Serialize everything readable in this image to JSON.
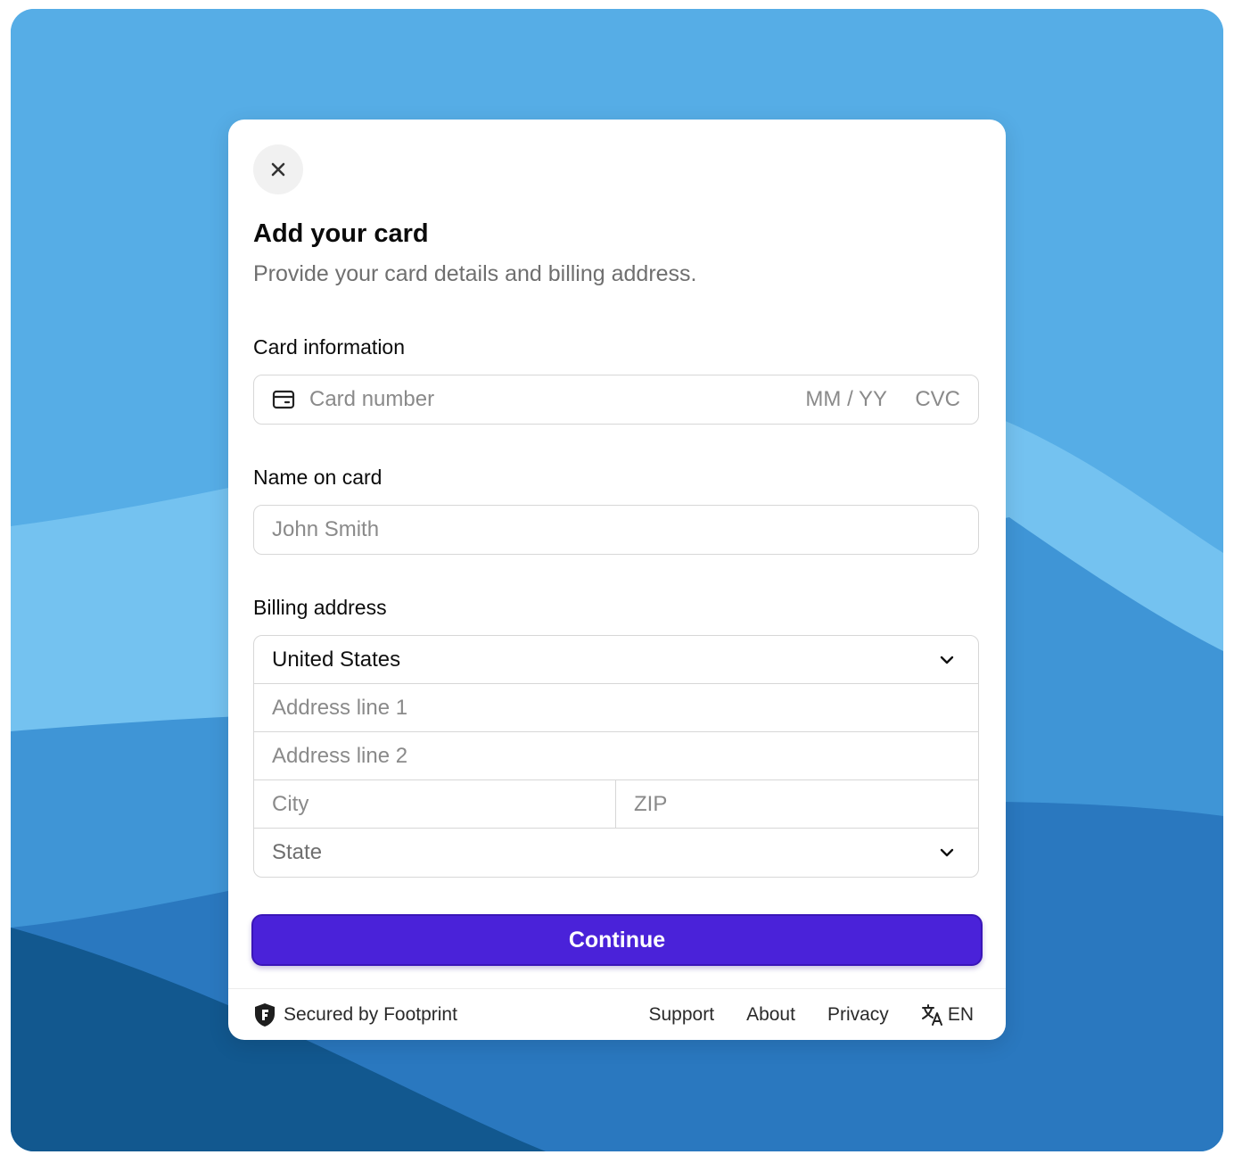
{
  "modal": {
    "title": "Add your card",
    "subtitle": "Provide your card details and billing address."
  },
  "icons": {
    "close": "close-icon",
    "card": "credit-card-icon",
    "chevron": "chevron-down-icon",
    "shield": "footprint-shield-icon",
    "language": "translate-icon"
  },
  "card_information": {
    "label": "Card information",
    "card_number_placeholder": "Card number",
    "expiry_placeholder": "MM / YY",
    "cvc_placeholder": "CVC"
  },
  "name_on_card": {
    "label": "Name on card",
    "placeholder": "John Smith"
  },
  "billing_address": {
    "label": "Billing address",
    "country_value": "United States",
    "address_line_1_placeholder": "Address line 1",
    "address_line_2_placeholder": "Address line 2",
    "city_placeholder": "City",
    "zip_placeholder": "ZIP",
    "state_placeholder": "State"
  },
  "continue_label": "Continue",
  "footer": {
    "secured_text": "Secured by Footprint",
    "links": [
      "Support",
      "About",
      "Privacy"
    ],
    "language": "EN"
  },
  "colors": {
    "primary_button": "#4a22d9",
    "background_blue": "#5aaee6"
  }
}
